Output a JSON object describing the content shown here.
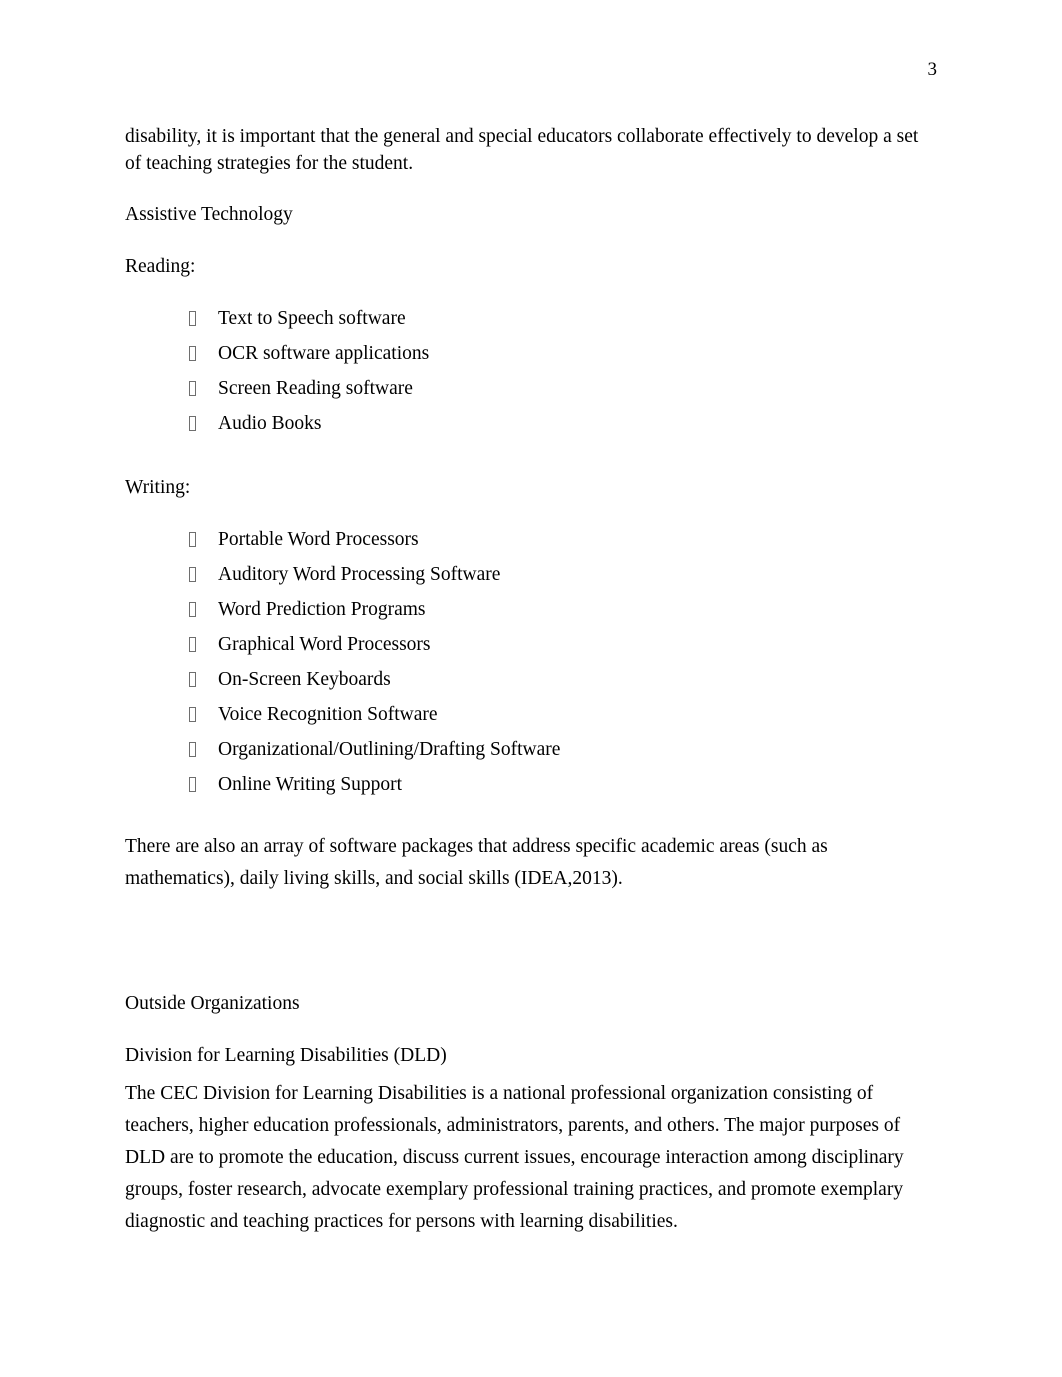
{
  "document": {
    "page_number": "3",
    "continued_paragraph": "disability, it is important that the general and special educators collaborate effectively to develop a set of teaching strategies for the student.",
    "sections": {
      "assistive_technology": {
        "heading": "Assistive Technology",
        "reading": {
          "label": "Reading:",
          "bullet_glyph": "missing-glyph-box",
          "items": [
            "Text to Speech software",
            "OCR software applications",
            "Screen Reading software",
            "Audio Books"
          ]
        },
        "writing": {
          "label": "Writing:",
          "bullet_glyph": "missing-glyph-box",
          "items": [
            "Portable Word Processors",
            "Auditory Word Processing Software",
            "Word Prediction Programs",
            "Graphical Word Processors",
            "On-Screen Keyboards",
            "Voice Recognition Software",
            "Organizational/Outlining/Drafting Software",
            "Online Writing Support"
          ]
        },
        "closing_paragraph": "There are also an array of software packages that address specific academic areas (such as mathematics), daily living skills, and social skills (IDEA,2013)."
      },
      "outside_organizations": {
        "heading": "Outside Organizations",
        "subheading": "Division for Learning Disabilities (DLD)",
        "body": "The CEC Division for Learning Disabilities is a national professional organization consisting of teachers, higher education professionals, administrators, parents, and others. The major purposes of DLD are to promote the education, discuss current issues, encourage interaction among disciplinary groups, foster research, advocate exemplary professional training practices, and promote exemplary diagnostic and teaching practices for persons with learning disabilities."
      }
    }
  },
  "colors": {
    "page_background": "#ffffff",
    "text": "#000000",
    "missing_glyph_border": "#6e6e6e"
  }
}
